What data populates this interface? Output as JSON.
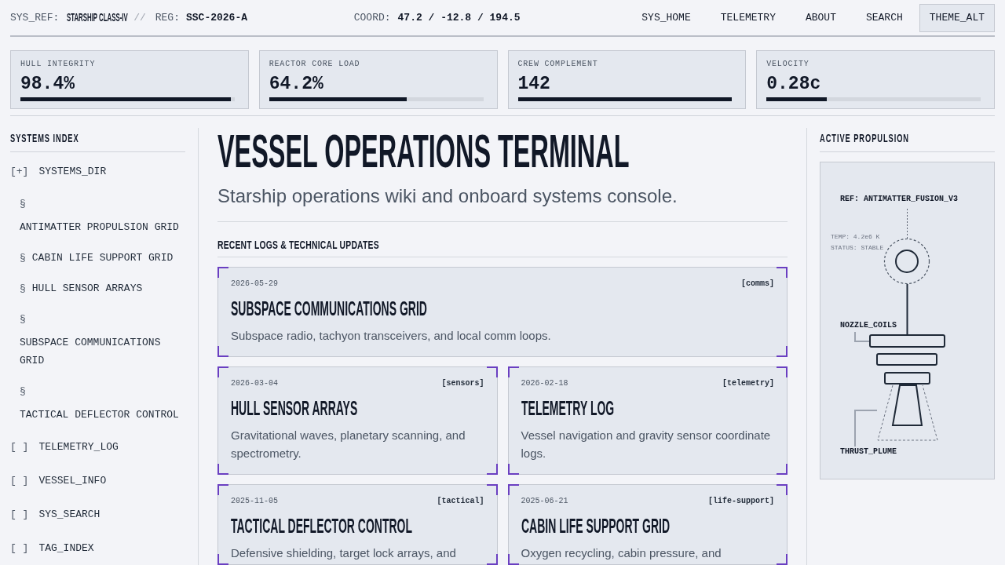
{
  "header": {
    "sys_ref": {
      "label": "SYS_REF:",
      "value": "STARSHIP CLASS-IV"
    },
    "separator": "//",
    "registry": {
      "label": "REG:",
      "value": "SSC-2026-A"
    },
    "coordinates": {
      "label": "COORD:",
      "value": "47.2 / -12.8 / 194.5"
    },
    "nav": [
      "SYS_HOME",
      "TELEMETRY",
      "ABOUT",
      "SEARCH"
    ],
    "theme_button": "THEME_ALT"
  },
  "stats": [
    {
      "label": "HULL INTEGRITY",
      "value": "98.4%",
      "level": 0.984
    },
    {
      "label": "REACTOR CORE LOAD",
      "value": "64.2%",
      "level": 0.642
    },
    {
      "label": "CREW COMPLEMENT",
      "value": "142",
      "level": 1
    },
    {
      "label": "VELOCITY",
      "value": "0.28c",
      "level": 0.28
    }
  ],
  "sidebar": {
    "title": "SYSTEMS INDEX",
    "items": [
      {
        "marker": "[+]",
        "label": "SYSTEMS_DIR",
        "children": [
          {
            "marker": "§",
            "label": "ANTIMATTER PROPULSION GRID"
          },
          {
            "marker": "§",
            "label": "CABIN LIFE SUPPORT GRID"
          },
          {
            "marker": "§",
            "label": "HULL SENSOR ARRAYS"
          },
          {
            "marker": "§",
            "label": "SUBSPACE COMMUNICATIONS GRID"
          },
          {
            "marker": "§",
            "label": "TACTICAL DEFLECTOR CONTROL"
          }
        ]
      },
      {
        "marker": "[ ]",
        "label": "TELEMETRY_LOG"
      },
      {
        "marker": "[ ]",
        "label": "VESSEL_INFO"
      },
      {
        "marker": "[ ]",
        "label": "SYS_SEARCH"
      },
      {
        "marker": "[ ]",
        "label": "TAG_INDEX"
      }
    ]
  },
  "main": {
    "title": "VESSEL OPERATIONS TERMINAL",
    "subtitle": "Starship operations wiki and onboard systems console.",
    "section_title": "RECENT LOGS & TECHNICAL UPDATES",
    "logs": [
      {
        "date": "2026-05-29",
        "tag": "[comms]",
        "title": "SUBSPACE COMMUNICATIONS GRID",
        "description": "Subspace radio, tachyon transceivers, and local comm loops.",
        "featured": true
      },
      {
        "date": "2026-03-04",
        "tag": "[sensors]",
        "title": "HULL SENSOR ARRAYS",
        "description": "Gravitational waves, planetary scanning, and spectrometry.",
        "featured": false
      },
      {
        "date": "2026-02-18",
        "tag": "[telemetry]",
        "title": "TELEMETRY LOG",
        "description": "Vessel navigation and gravity sensor coordinate logs.",
        "featured": false
      },
      {
        "date": "2025-11-05",
        "tag": "[tactical]",
        "title": "TACTICAL DEFLECTOR CONTROL",
        "description": "Defensive shielding, target lock arrays, and",
        "featured": false
      },
      {
        "date": "2025-06-21",
        "tag": "[life-support]",
        "title": "CABIN LIFE SUPPORT GRID",
        "description": "Oxygen recycling, cabin pressure, and",
        "featured": false
      }
    ]
  },
  "propulsion_panel": {
    "title": "ACTIVE PROPULSION",
    "diagram": {
      "ref": "REF: ANTIMATTER_FUSION_V3",
      "temp": "TEMP: 4.2e6 K",
      "status": "STATUS: STABLE",
      "nozzle_label": "NOZZLE_COILS",
      "plume_label": "THRUST_PLUME"
    }
  }
}
